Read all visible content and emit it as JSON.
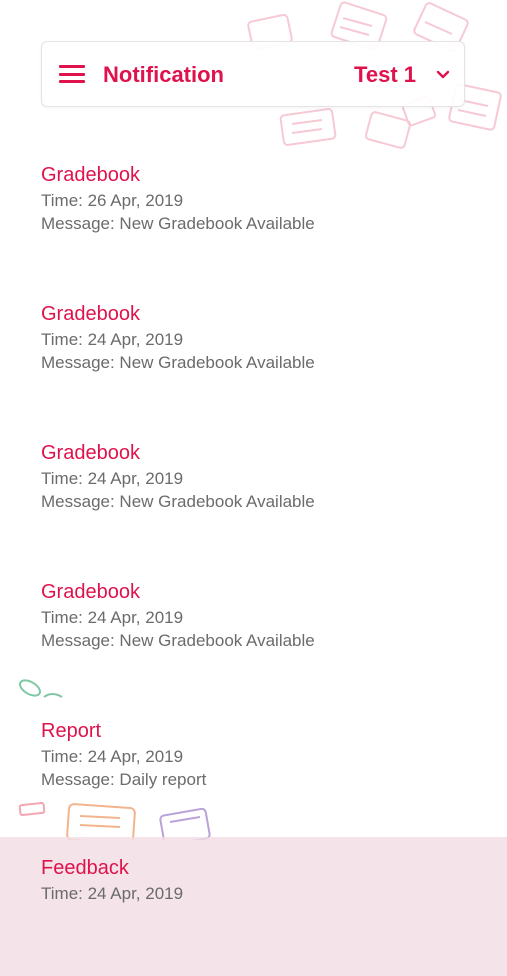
{
  "header": {
    "title": "Notification",
    "selector_label": "Test 1",
    "menu_icon": "hamburger-menu-icon",
    "chevron_icon": "chevron-down-icon"
  },
  "notifications": [
    {
      "title": "Gradebook",
      "time": "Time: 26 Apr, 2019",
      "message": "Message: New Gradebook Available"
    },
    {
      "title": "Gradebook",
      "time": "Time: 24 Apr, 2019",
      "message": "Message: New Gradebook Available"
    },
    {
      "title": "Gradebook",
      "time": "Time: 24 Apr, 2019",
      "message": "Message: New Gradebook Available"
    },
    {
      "title": "Gradebook",
      "time": "Time: 24 Apr, 2019",
      "message": "Message: New Gradebook Available"
    },
    {
      "title": "Report",
      "time": "Time: 24 Apr, 2019",
      "message": "Message: Daily report"
    },
    {
      "title": "Feedback",
      "time": "Time: 24 Apr, 2019",
      "message": ""
    }
  ],
  "colors": {
    "accent": "#e0124d",
    "text_secondary": "#6b6b6b",
    "highlight_row": "#f2dde4"
  }
}
